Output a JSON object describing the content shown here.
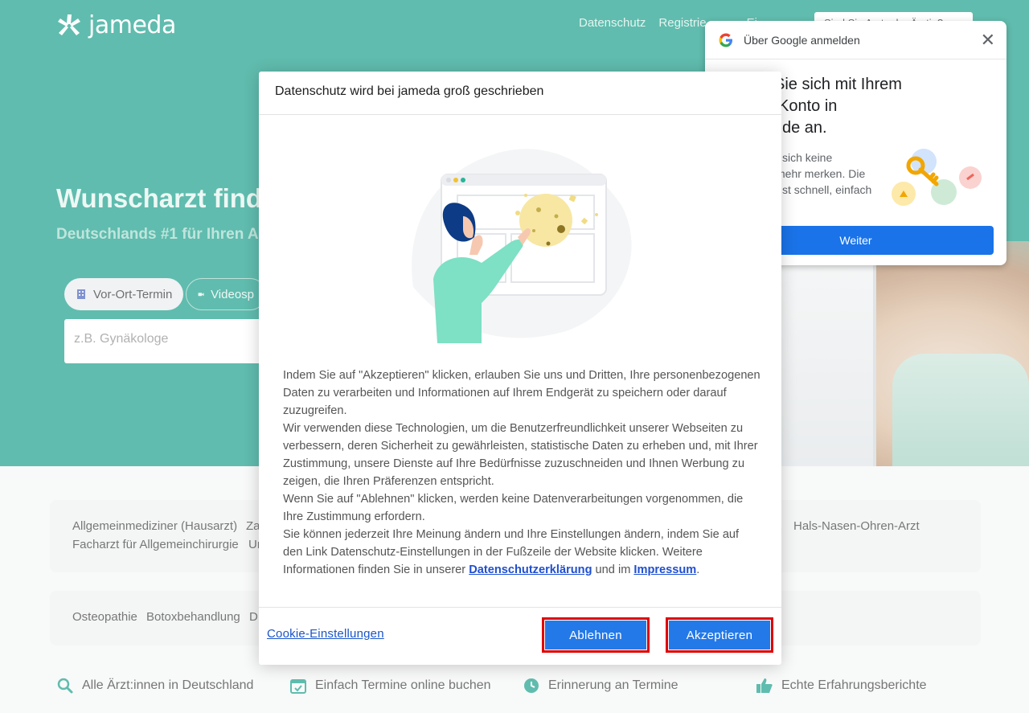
{
  "header": {
    "logo_text": "jameda",
    "nav": [
      "Datenschutz",
      "Registrie",
      "Ei"
    ],
    "doctor_button": "Sind Sie Arzt oder Ärztin?"
  },
  "hero": {
    "title": "Wunscharzt finde",
    "subtitle": "Deutschlands #1 für Ihren A",
    "tabs": [
      {
        "label": "Vor-Ort-Termin",
        "icon": "building-icon"
      },
      {
        "label": "Videosp",
        "icon": "video-icon"
      }
    ],
    "search_placeholder": "z.B. Gynäkologe"
  },
  "categories": {
    "row1_left": "Allgemeinmediziner (Hausarzt)",
    "row1_mid": "Za",
    "row1_right_a": "t",
    "row1_right_b": "Hals-Nasen-Ohren-Arzt",
    "row2_left": "Facharzt für Allgemeinchirurgie",
    "row2_mid": "Ur",
    "row3_a": "Osteopathie",
    "row3_b": "Botoxbehandlung",
    "row3_c": "D"
  },
  "features": [
    {
      "icon": "search-icon",
      "label": "Alle Ärzt:innen in Deutschland"
    },
    {
      "icon": "calendar-check-icon",
      "label": "Einfach Termine online buchen"
    },
    {
      "icon": "clock-icon",
      "label": "Erinnerung an Termine"
    },
    {
      "icon": "thumbs-up-icon",
      "label": "Echte Erfahrungsberichte"
    }
  ],
  "google_popup": {
    "title": "Über Google anmelden",
    "heading_lines": [
      "Sie sich mit Ihrem",
      "Konto in",
      "de an."
    ],
    "text_lines": [
      "sich keine",
      "mehr merken. Die",
      "st schnell, einfach"
    ],
    "button": "Weiter",
    "close_icon": "close-icon"
  },
  "modal": {
    "title": "Datenschutz wird bei jameda groß geschrieben",
    "p1": "Indem Sie auf \"Akzeptieren\" klicken, erlauben Sie uns und Dritten, Ihre personenbezogenen Daten zu verarbeiten und Informationen auf Ihrem Endgerät zu speichern oder darauf zuzugreifen.",
    "p2": "Wir verwenden diese Technologien, um die Benutzerfreundlichkeit unserer Webseiten zu verbessern, deren Sicherheit zu gewährleisten, statistische Daten zu erheben und, mit Ihrer Zustimmung, unsere Dienste auf Ihre Bedürfnisse zuzuschneiden und Ihnen Werbung zu zeigen, die Ihren Präferenzen entspricht.",
    "p3": "Wenn Sie auf \"Ablehnen\" klicken, werden keine Datenverarbeitungen vorgenommen, die Ihre Zustimmung erfordern.",
    "p4_start": "Sie können jederzeit Ihre Meinung ändern und Ihre Einstellungen ändern, indem Sie auf den Link Datenschutz-Einstellungen in der Fußzeile der Website klicken. Weitere Informationen finden Sie in unserer ",
    "link_privacy": "Datenschutzerklärung",
    "p4_mid": " und im ",
    "link_imprint": "Impressum",
    "p4_end": ".",
    "cookie_settings": "Cookie-Einstellungen",
    "decline": "Ablehnen",
    "accept": "Akzeptieren"
  },
  "colors": {
    "brand": "#0b9983",
    "primary_button": "#2479e8",
    "highlight_border": "#e00000",
    "google_blue": "#1a73e8"
  }
}
